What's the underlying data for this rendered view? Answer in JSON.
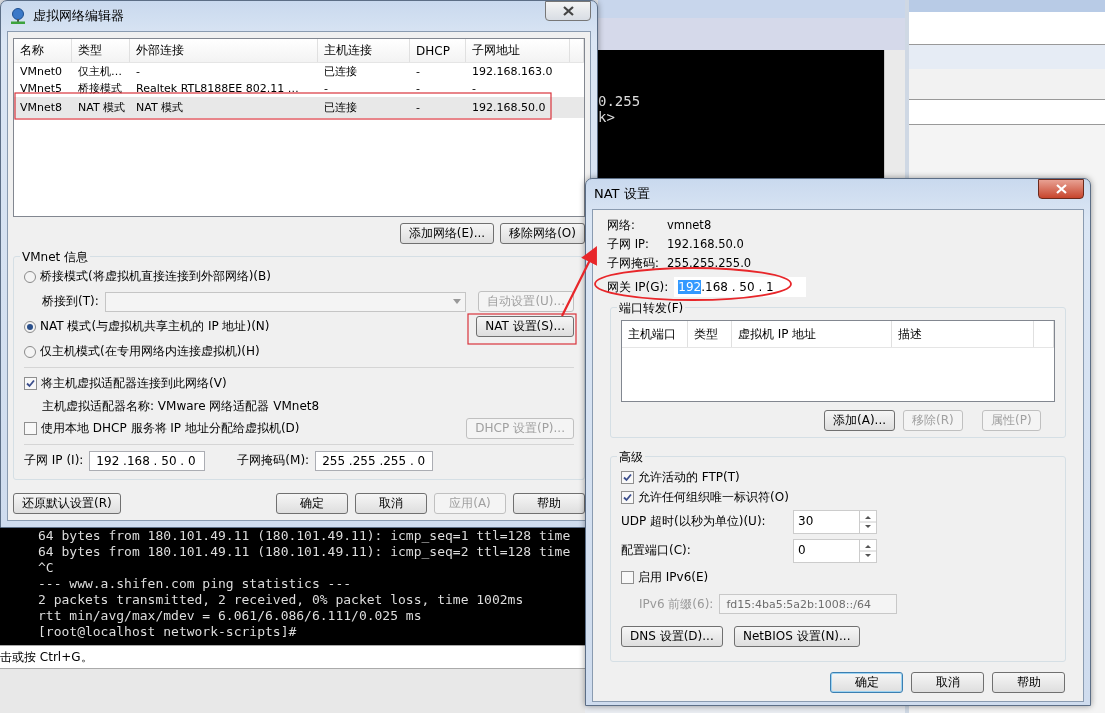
{
  "background": {
    "top_terminal_lines": [
      "0.255",
      "k>"
    ],
    "bottom_terminal_lines": [
      "64 bytes from 180.101.49.11 (180.101.49.11): icmp_seq=1 ttl=128 time",
      "64 bytes from 180.101.49.11 (180.101.49.11): icmp_seq=2 ttl=128 time",
      "^C",
      "--- www.a.shifen.com ping statistics ---",
      "2 packets transmitted, 2 received, 0% packet loss, time 1002ms",
      "rtt min/avg/max/mdev = 6.061/6.086/6.111/0.025 ms",
      "[root@localhost network-scripts]#"
    ],
    "status_text": "击或按 Ctrl+G。"
  },
  "network_editor": {
    "title": "虚拟网络编辑器",
    "table": {
      "columns": [
        "名称",
        "类型",
        "外部连接",
        "主机连接",
        "DHCP",
        "子网地址"
      ],
      "rows": [
        {
          "cells": [
            "VMnet0",
            "仅主机…",
            "-",
            "已连接",
            "-",
            "192.168.163.0"
          ],
          "selected": false
        },
        {
          "cells": [
            "VMnet5",
            "桥接模式",
            "Realtek RTL8188EE 802.11 …",
            "-",
            "-",
            "-"
          ],
          "selected": false
        },
        {
          "cells": [
            "VMnet8",
            "NAT 模式",
            "NAT 模式",
            "已连接",
            "-",
            "192.168.50.0"
          ],
          "selected": true
        }
      ]
    },
    "table_buttons": [
      {
        "label": "添加网络(E)...",
        "disabled": false
      },
      {
        "label": "移除网络(O)",
        "disabled": false
      }
    ],
    "vmnet_info": {
      "title": "VMnet 信息",
      "bridged_mode": {
        "label": "桥接模式(将虚拟机直接连接到外部网络)(B)",
        "selected": false
      },
      "bridge_to": {
        "label": "桥接到(T):",
        "disabled": true
      },
      "auto_settings_button": {
        "label": "自动设置(U)...",
        "disabled": true
      },
      "nat_mode": {
        "label": "NAT 模式(与虚拟机共享主机的 IP 地址)(N)",
        "selected": true
      },
      "nat_settings_button": {
        "label": "NAT 设置(S)...",
        "disabled": false
      },
      "host_only_mode": {
        "label": "仅主机模式(在专用网络内连接虚拟机)(H)",
        "selected": false
      },
      "host_adapter_checkbox": {
        "label": "将主机虚拟适配器连接到此网络(V)",
        "checked": true
      },
      "adapter_name": "主机虚拟适配器名称: VMware 网络适配器 VMnet8",
      "dhcp_checkbox": {
        "label": "使用本地 DHCP 服务将 IP 地址分配给虚拟机(D)",
        "checked": false
      },
      "dhcp_settings_button": {
        "label": "DHCP 设置(P)...",
        "disabled": true
      },
      "subnet_ip": {
        "label": "子网 IP (I):",
        "value": "192 .168 . 50 . 0"
      },
      "subnet_mask": {
        "label": "子网掩码(M):",
        "value": "255 .255 .255 . 0"
      }
    },
    "restore_button": {
      "label": "还原默认设置(R)",
      "disabled": false
    },
    "footer_buttons": [
      {
        "label": "确定",
        "disabled": false
      },
      {
        "label": "取消",
        "disabled": false
      },
      {
        "label": "应用(A)",
        "disabled": true
      },
      {
        "label": "帮助",
        "disabled": false
      }
    ]
  },
  "nat_settings": {
    "title": "NAT 设置",
    "info": [
      {
        "label": "网络:",
        "value": "vmnet8"
      },
      {
        "label": "子网 IP:",
        "value": "192.168.50.0"
      },
      {
        "label": "子网掩码:",
        "value": "255.255.255.0"
      }
    ],
    "gateway": {
      "label": "网关 IP(G):",
      "parts": [
        {
          "text": "192",
          "selected": true
        },
        {
          "text": ".168 . 50 . 1",
          "selected": false
        }
      ]
    },
    "port_forwarding": {
      "title": "端口转发(F)",
      "columns": [
        "主机端口",
        "类型",
        "虚拟机 IP 地址",
        "描述"
      ],
      "buttons": [
        {
          "label": "添加(A)...",
          "disabled": false
        },
        {
          "label": "移除(R)",
          "disabled": true
        },
        {
          "label": "属性(P)",
          "disabled": true
        }
      ]
    },
    "advanced": {
      "title": "高级",
      "checkboxes": [
        {
          "label": "允许活动的 FTP(T)",
          "checked": true
        },
        {
          "label": "允许任何组织唯一标识符(O)",
          "checked": true
        }
      ],
      "spinners": [
        {
          "label": "UDP 超时(以秒为单位)(U):",
          "value": "30"
        },
        {
          "label": "配置端口(C):",
          "value": "0"
        }
      ],
      "ipv6_checkbox": {
        "label": "启用 IPv6(E)",
        "checked": false
      },
      "ipv6_prefix": {
        "label": "IPv6 前缀(6):",
        "value": "fd15:4ba5:5a2b:1008::/64",
        "disabled": true
      },
      "buttons": [
        {
          "label": "DNS 设置(D)...",
          "disabled": false
        },
        {
          "label": "NetBIOS 设置(N)...",
          "disabled": false
        }
      ]
    },
    "footer_buttons": [
      {
        "label": "确定",
        "default": true
      },
      {
        "label": "取消",
        "default": false
      },
      {
        "label": "帮助",
        "default": false
      }
    ]
  }
}
